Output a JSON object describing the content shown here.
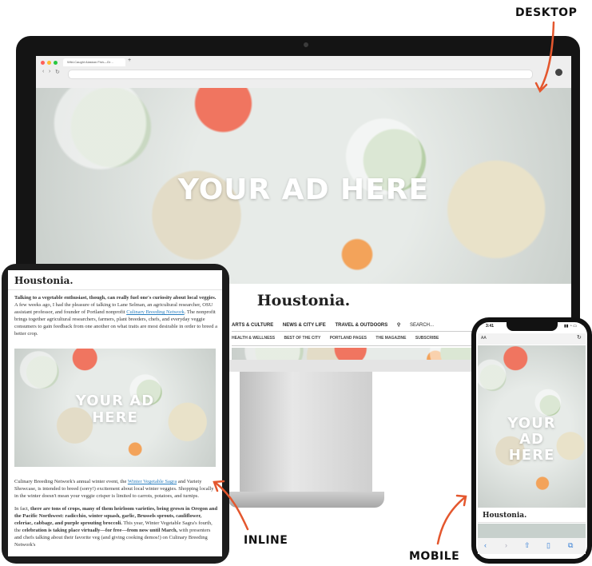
{
  "callouts": {
    "desktop": "DESKTOP",
    "inline": "INLINE",
    "mobile": "MOBILE"
  },
  "colors": {
    "arrow": "#e4572e",
    "link": "#2a7fbf",
    "device_frame": "#141414"
  },
  "desktop": {
    "browser_tab_title": "Wild-Caught Alaskan Fish—Gr…",
    "hero_ad": "YOUR AD HERE",
    "site_logo": "Houstonia.",
    "nav_primary": [
      "ARTS & CULTURE",
      "NEWS & CITY LIFE",
      "TRAVEL & OUTDOORS",
      "SEARCH..."
    ],
    "nav_secondary": [
      "HEALTH & WELLNESS",
      "BEST OF THE CITY",
      "PORTLAND PAGES",
      "THE MAGAZINE",
      "SUBSCRIBE"
    ],
    "search_icon": "search-icon"
  },
  "tablet": {
    "site_logo": "Houstonia.",
    "para1_bold": "Talking to a vegetable enthusiast, though, can really fuel one's curiosity about local veggies.",
    "para1_text_a": " A few weeks ago, I had the pleasure of talking to Lane Selman, an agricultural researcher, OSU assistant professor, and founder of Portland nonprofit ",
    "para1_link": "Culinary Breeding Network",
    "para1_text_b": ". The nonprofit brings together agricultural researchers, farmers, plant breeders, chefs, and everyday veggie consumers to gain feedback from one another on what traits are most desirable in order to breed a better crop.",
    "ad_line1": "YOUR AD",
    "ad_line2": "HERE",
    "para2_text_a": "Culinary Breeding Network's annual winter event, the ",
    "para2_link": "Winter Vegetable Sagra",
    "para2_text_b": " and Variety Showcase, is intended to breed (sorry!) excitement about local winter veggies. Shopping locally in the winter doesn't mean your veggie crisper is limited to carrots, potatoes, and turnips.",
    "para3_text_a": "In fact, ",
    "para3_bold_a": "there are tons of crops, many of them heirloom varieties, being grown in Oregon and the Pacific Northwest: radicchio, winter squash, garlic, Brussels sprouts, cauliflower, celeriac, cabbage, and purple sprouting broccoli.",
    "para3_text_b": " This year, Winter Vegetable Sagra's fourth, the ",
    "para3_bold_b": "celebration is taking place virtually—for free—from now until March,",
    "para3_text_c": " with presenters and chefs talking about their favorite veg (and giving cooking demos!) on Culinary Breeding Network's"
  },
  "phone": {
    "time": "3:41",
    "url_aa": "AA",
    "ad_line1": "YOUR",
    "ad_line2": "AD",
    "ad_line3": "HERE",
    "site_logo": "Houstonia.",
    "toolbar_icons": [
      "back-icon",
      "forward-icon",
      "share-icon",
      "bookmarks-icon",
      "tabs-icon"
    ]
  }
}
